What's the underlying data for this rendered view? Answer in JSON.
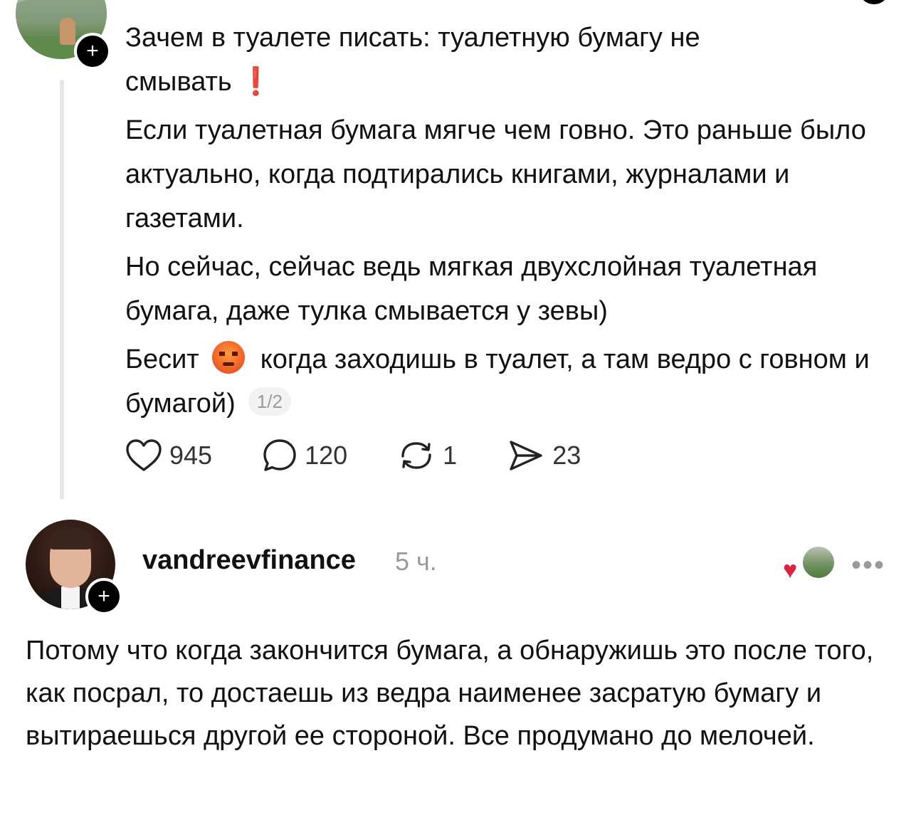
{
  "post": {
    "text_line1": "Зачем в туалете писать: туалетную бумагу не",
    "text_line2": "смывать",
    "exclamation": "❗",
    "paragraph2": "Если туалетная бумага мягче чем говно. Это раньше было актуально, когда подтирались книгами, журналами и газетами.",
    "paragraph3": "Но сейчас, сейчас ведь мягкая двухслойная туалетная бумага, даже тулка смывается у зевы)",
    "paragraph4_before": "Бесит",
    "paragraph4_after": "когда заходишь в туалет, а там ведро с говном и бумагой)",
    "page_indicator": "1/2",
    "likes": "945",
    "comments": "120",
    "reposts": "1",
    "shares": "23"
  },
  "reply": {
    "username": "vandreevfinance",
    "time": "5 ч.",
    "more": "•••",
    "text": "Потому что когда закончится бумага, а обнаружишь это после того, как посрал, то достаешь из ведра наименее засратую бумагу и вытираешься другой ее стороной. Все продумано до мелочей."
  },
  "icons": {
    "follow": "plus-icon",
    "like": "heart-icon",
    "comment": "comment-bubble-icon",
    "repost": "repost-icon",
    "share": "send-icon",
    "emoji": "angry-face-emoji",
    "liked_by_author": "heart-icon"
  },
  "colors": {
    "text": "#111111",
    "muted": "#9a9a9a",
    "thread_line": "#e6e6e6",
    "heart_red": "#e0213b"
  }
}
